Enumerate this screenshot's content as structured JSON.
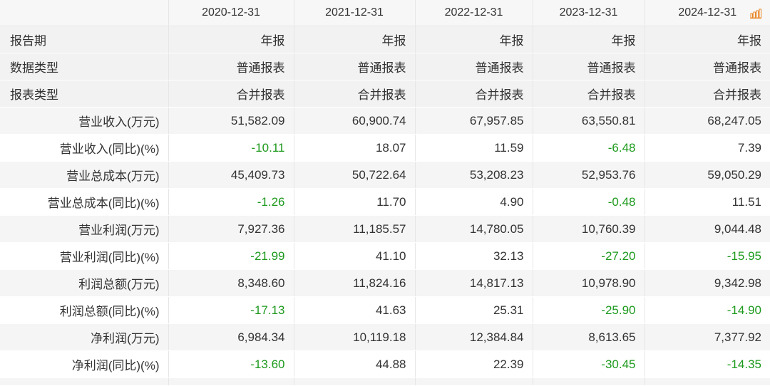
{
  "columns": [
    "2020-12-31",
    "2021-12-31",
    "2022-12-31",
    "2023-12-31",
    "2024-12-31"
  ],
  "meta_rows": [
    {
      "label": "报告期",
      "values": [
        "年报",
        "年报",
        "年报",
        "年报",
        "年报"
      ]
    },
    {
      "label": "数据类型",
      "values": [
        "普通报表",
        "普通报表",
        "普通报表",
        "普通报表",
        "普通报表"
      ]
    },
    {
      "label": "报表类型",
      "values": [
        "合并报表",
        "合并报表",
        "合并报表",
        "合并报表",
        "合并报表"
      ]
    }
  ],
  "data_rows": [
    {
      "label": "营业收入(万元)",
      "values": [
        "51,582.09",
        "60,900.74",
        "67,957.85",
        "63,550.81",
        "68,247.05"
      ]
    },
    {
      "label": "营业收入(同比)(%)",
      "values": [
        "-10.11",
        "18.07",
        "11.59",
        "-6.48",
        "7.39"
      ]
    },
    {
      "label": "营业总成本(万元)",
      "values": [
        "45,409.73",
        "50,722.64",
        "53,208.23",
        "52,953.76",
        "59,050.29"
      ]
    },
    {
      "label": "营业总成本(同比)(%)",
      "values": [
        "-1.26",
        "11.70",
        "4.90",
        "-0.48",
        "11.51"
      ]
    },
    {
      "label": "营业利润(万元)",
      "values": [
        "7,927.36",
        "11,185.57",
        "14,780.05",
        "10,760.39",
        "9,044.48"
      ]
    },
    {
      "label": "营业利润(同比)(%)",
      "values": [
        "-21.99",
        "41.10",
        "32.13",
        "-27.20",
        "-15.95"
      ]
    },
    {
      "label": "利润总额(万元)",
      "values": [
        "8,348.60",
        "11,824.16",
        "14,817.13",
        "10,978.90",
        "9,342.98"
      ]
    },
    {
      "label": "利润总额(同比)(%)",
      "values": [
        "-17.13",
        "41.63",
        "25.31",
        "-25.90",
        "-14.90"
      ]
    },
    {
      "label": "净利润(万元)",
      "values": [
        "6,984.34",
        "10,119.18",
        "12,384.84",
        "8,613.65",
        "7,377.92"
      ]
    },
    {
      "label": "净利润(同比)(%)",
      "values": [
        "-13.60",
        "44.88",
        "22.39",
        "-30.45",
        "-14.35"
      ]
    }
  ],
  "icons": {
    "row_chart": "bar-chart-icon"
  },
  "colors": {
    "negative": "#1d9a1d",
    "icon": "#e8821e",
    "header_bg": "#f7f7f7"
  }
}
